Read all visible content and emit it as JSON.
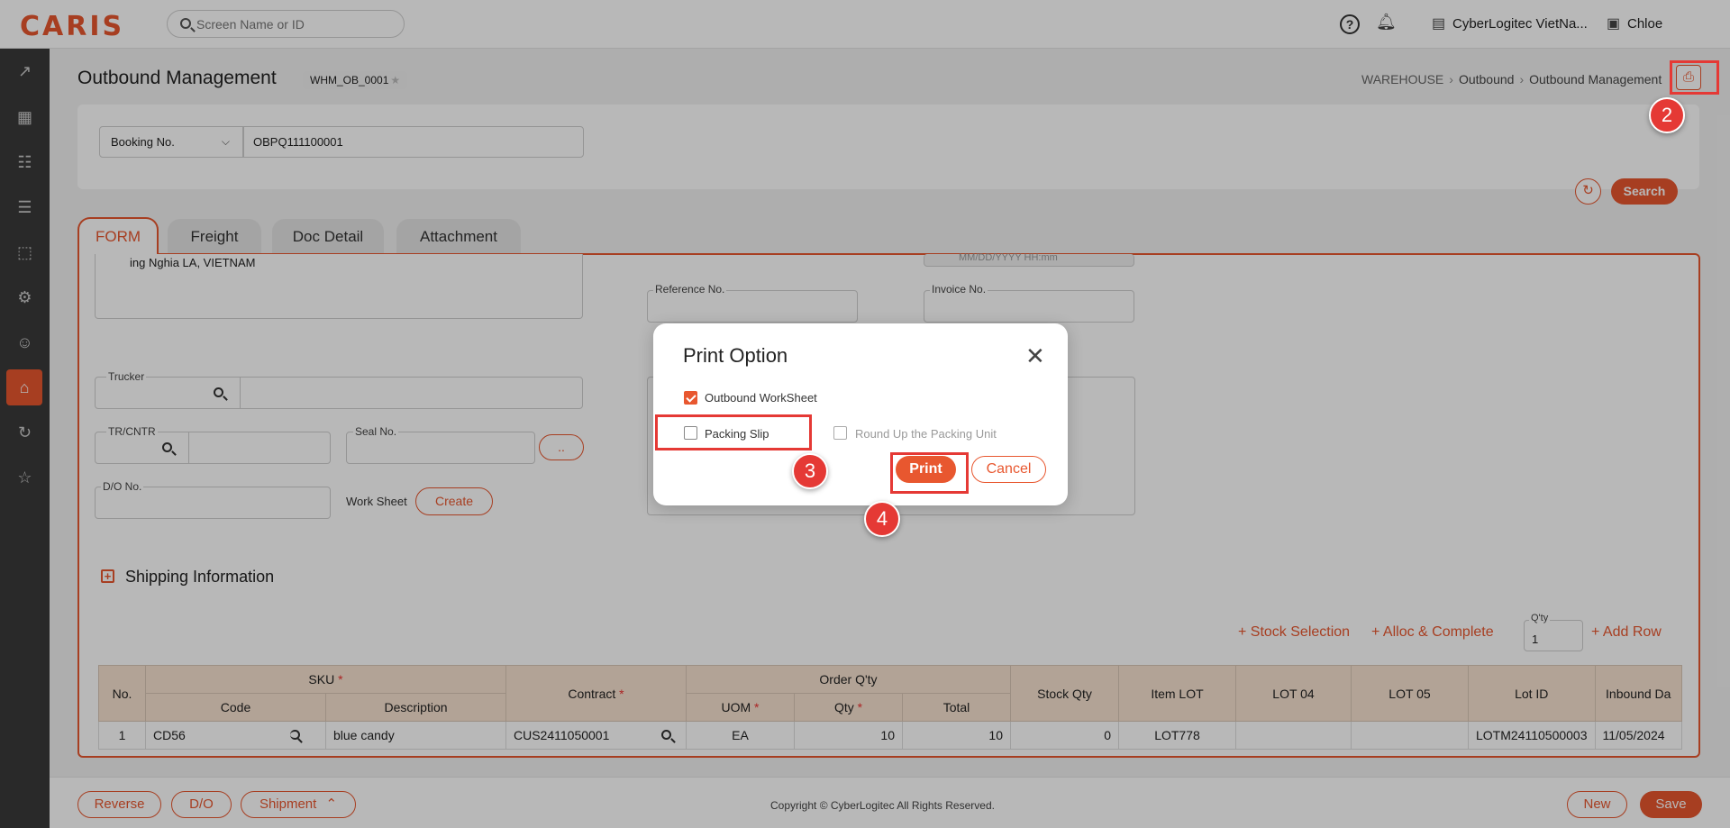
{
  "app": {
    "logo": "CARIS"
  },
  "topbar": {
    "search_placeholder": "Screen Name or ID",
    "company": "CyberLogitec VietNa...",
    "user": "Chloe",
    "help_glyph": "?"
  },
  "sidebar": {
    "icons": [
      "dashboard-chart-icon",
      "truck-icon",
      "billing-icon",
      "document-icon",
      "box-icon",
      "database-settings-icon",
      "user-settings-icon",
      "warehouse-icon",
      "history-icon",
      "star-icon"
    ],
    "active": "warehouse-icon"
  },
  "page": {
    "title": "Outbound Management",
    "screen_code": "WHM_OB_0001",
    "breadcrumb": [
      "WAREHOUSE",
      "Outbound",
      "Outbound Management"
    ]
  },
  "search": {
    "field_select": "Booking No.",
    "field_value": "OBPQ111100001",
    "search_label": "Search"
  },
  "tabs": [
    "FORM",
    "Freight",
    "Doc Detail",
    "Attachment"
  ],
  "form": {
    "address_text": "ing Nghia LA, VIETNAM",
    "reference_label": "Reference No.",
    "invoice_label": "Invoice No.",
    "date_placeholder": "MM/DD/YYYY HH:mm",
    "trucker_label": "Trucker",
    "trcntr_label": "TR/CNTR",
    "seal_label": "Seal No.",
    "ellipsis_label": "..",
    "do_label": "D/O No.",
    "worksheet_label": "Work Sheet",
    "create_label": "Create",
    "shipping_info": "Shipping Information",
    "stock_selection": "+ Stock Selection",
    "alloc_complete": "+ Alloc & Complete",
    "qty_label": "Q'ty",
    "qty_value": "1",
    "add_row": "+ Add Row"
  },
  "grid": {
    "headers": {
      "no": "No.",
      "sku": "SKU",
      "code": "Code",
      "description": "Description",
      "contract": "Contract",
      "order_qty": "Order Q'ty",
      "uom": "UOM",
      "qty": "Qty",
      "total": "Total",
      "stock_qty": "Stock Qty",
      "item_lot": "Item LOT",
      "lot04": "LOT 04",
      "lot05": "LOT 05",
      "lot_id": "Lot ID",
      "inbound_date": "Inbound Da"
    },
    "required_mark": "*",
    "rows": [
      {
        "no": "1",
        "code": "CD56",
        "description": "blue candy",
        "contract": "CUS2411050001",
        "uom": "EA",
        "qty": "10",
        "total": "10",
        "stock_qty": "0",
        "item_lot": "LOT778",
        "lot04": "",
        "lot05": "",
        "lot_id": "LOTM24110500003",
        "inbound_date": "11/05/2024"
      }
    ]
  },
  "footer": {
    "reverse": "Reverse",
    "do": "D/O",
    "shipment": "Shipment",
    "copyright": "Copyright © CyberLogitec All Rights Reserved.",
    "new": "New",
    "save": "Save"
  },
  "dialog": {
    "title": "Print Option",
    "options": [
      {
        "label": "Outbound WorkSheet",
        "checked": true,
        "disabled": false
      },
      {
        "label": "Packing Slip",
        "checked": false,
        "disabled": false
      },
      {
        "label": "Round Up the Packing Unit",
        "checked": false,
        "disabled": true
      }
    ],
    "print_label": "Print",
    "cancel_label": "Cancel"
  },
  "annotations": [
    "2",
    "3",
    "4"
  ],
  "colors": {
    "accent": "#e8572f",
    "marker": "#e53935"
  }
}
